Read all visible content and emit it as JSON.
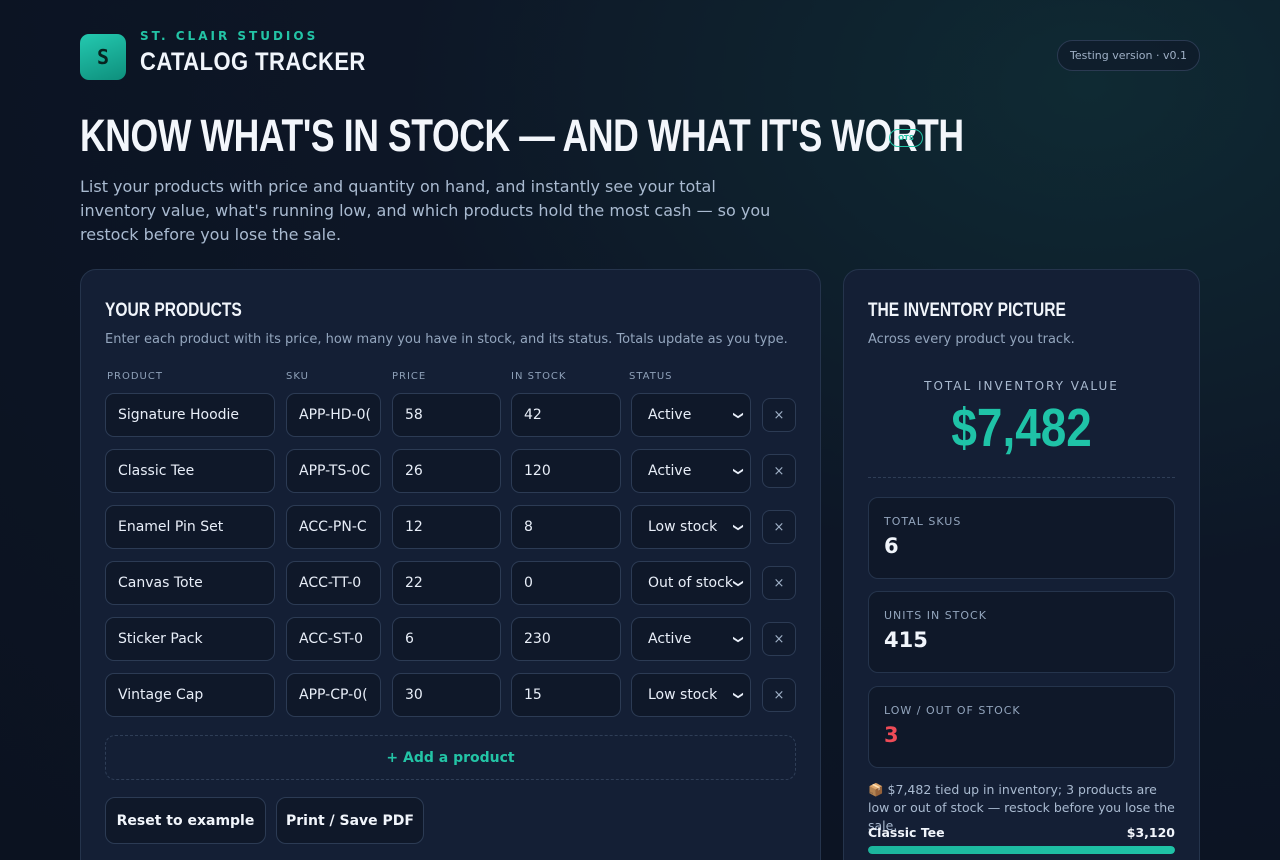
{
  "brand": {
    "studio": "ST. CLAIR STUDIOS",
    "app": "CATALOG TRACKER",
    "logo_letter": "S"
  },
  "version": "Testing version · v0.1",
  "hero": {
    "title": "KNOW WHAT'S IN STOCK — AND WHAT IT'S WORTH",
    "badge": "OTS",
    "description": "List your products with price and quantity on hand, and instantly see your total inventory value, what's running low, and which products hold the most cash — so you restock before you lose the sale."
  },
  "products_panel": {
    "title": "YOUR PRODUCTS",
    "subtitle": "Enter each product with its price, how many you have in stock, and its status. Totals update as you type.",
    "columns": [
      "PRODUCT",
      "SKU",
      "PRICE",
      "IN STOCK",
      "STATUS"
    ],
    "rows": [
      {
        "name": "Signature Hoodie",
        "sku": "APP-HD-0(",
        "price": "58",
        "stock": "42",
        "status": "Active"
      },
      {
        "name": "Classic Tee",
        "sku": "APP-TS-0C",
        "price": "26",
        "stock": "120",
        "status": "Active"
      },
      {
        "name": "Enamel Pin Set",
        "sku": "ACC-PN-C",
        "price": "12",
        "stock": "8",
        "status": "Low stock"
      },
      {
        "name": "Canvas Tote",
        "sku": "ACC-TT-0",
        "price": "22",
        "stock": "0",
        "status": "Out of stock"
      },
      {
        "name": "Sticker Pack",
        "sku": "ACC-ST-0",
        "price": "6",
        "stock": "230",
        "status": "Active"
      },
      {
        "name": "Vintage Cap",
        "sku": "APP-CP-0(",
        "price": "30",
        "stock": "15",
        "status": "Low stock"
      }
    ],
    "remove_symbol": "×",
    "add_label": "+ Add a product",
    "reset_label": "Reset to example",
    "print_label": "Print / Save PDF"
  },
  "picture_panel": {
    "title": "THE INVENTORY PICTURE",
    "subtitle": "Across every product you track.",
    "total_label": "TOTAL INVENTORY VALUE",
    "total_value": "$7,482",
    "stats": [
      {
        "label": "TOTAL SKUS",
        "value": "6"
      },
      {
        "label": "UNITS IN STOCK",
        "value": "415"
      },
      {
        "label": "LOW / OUT OF STOCK",
        "value": "3"
      }
    ],
    "summary": "📦 $7,482 tied up in inventory; 3 products are low or out of stock — restock before you lose the sale.",
    "top_product": {
      "name": "Classic Tee",
      "value": "$3,120",
      "share": 1.0
    }
  },
  "colors": {
    "accent": "#1fc3a7",
    "alert": "#ef4b57",
    "panel": "#141f35",
    "background": "#0b1220"
  }
}
